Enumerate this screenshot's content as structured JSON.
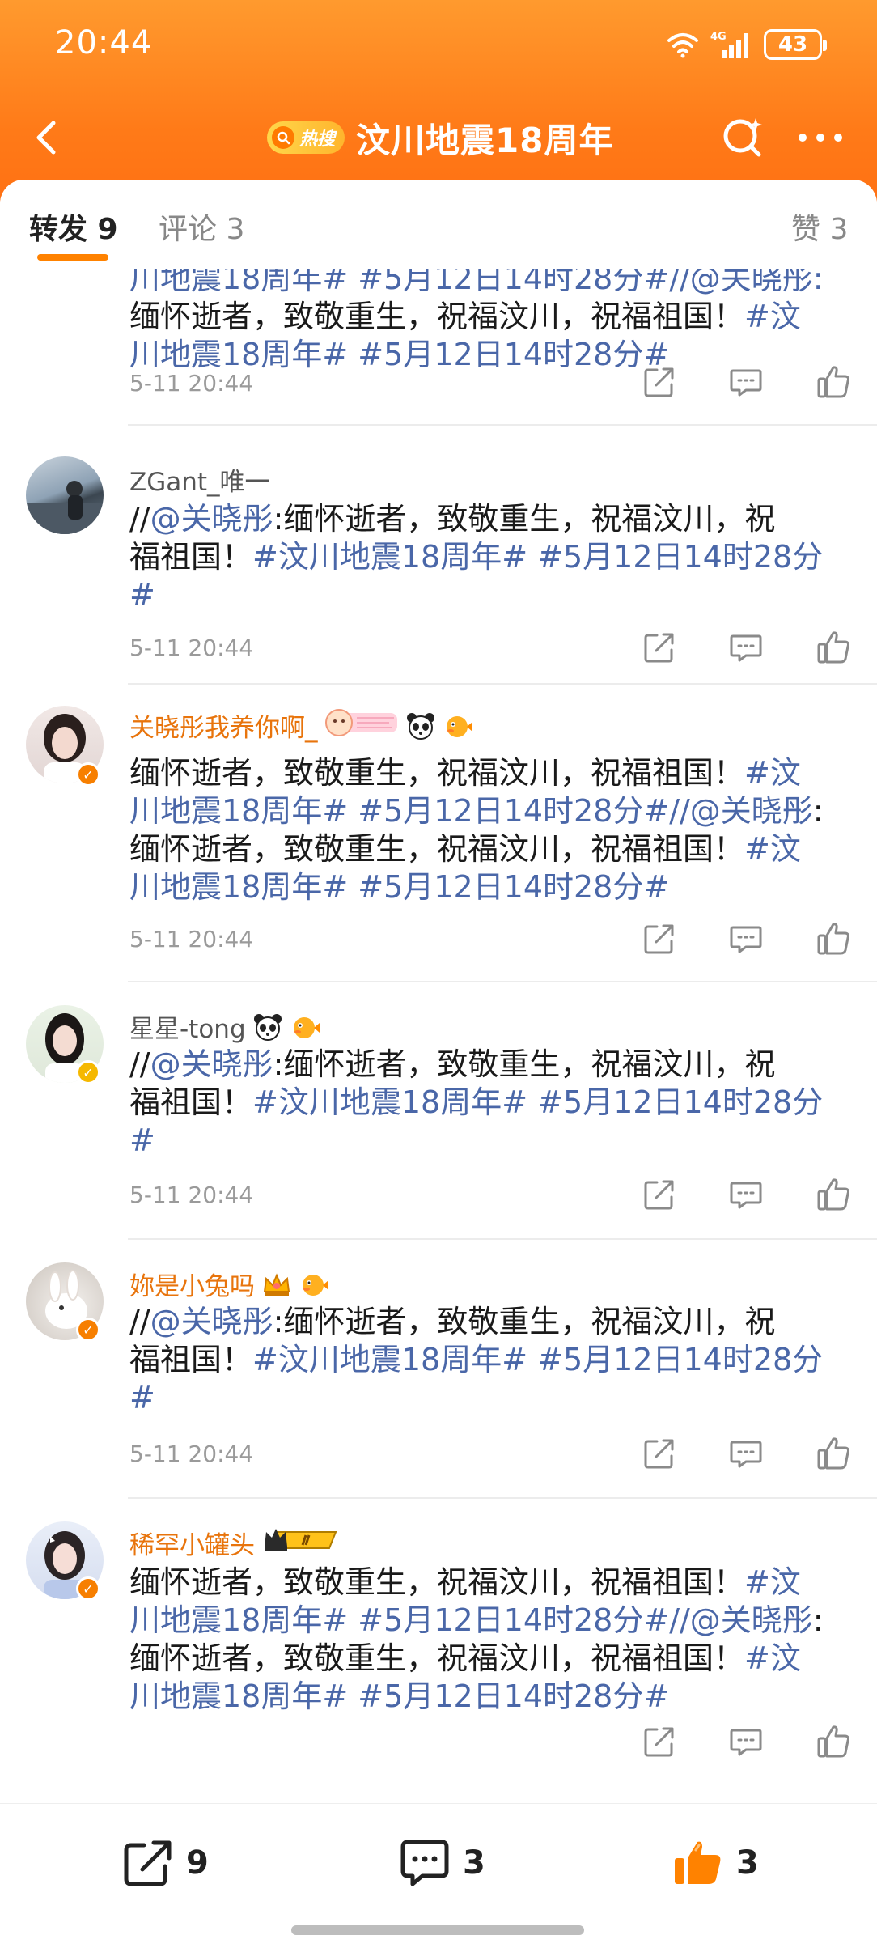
{
  "status": {
    "time": "20:44",
    "network": "4G",
    "battery": "43"
  },
  "nav": {
    "hot_badge": "热搜",
    "title": "汶川地震18周年",
    "icons": [
      "back-arrow-icon",
      "search-icon",
      "more-icon"
    ]
  },
  "tabs": {
    "repost_label": "转发 9",
    "comment_label": "评论 3",
    "like_label": "赞 3"
  },
  "posts": [
    {
      "username": "",
      "text_plain": "",
      "text_lines": [
        [
          {
            "t": "川地震18周年# #5月12日14时28分#//@关晓彤:",
            "link": true
          }
        ],
        [
          {
            "t": "缅怀逝者，致敬重生，祝福汶川，祝福祖国！",
            "link": false
          },
          {
            "t": "#汶",
            "link": true
          }
        ],
        [
          {
            "t": "川地震18周年# #5月12日14时28分#",
            "link": true
          }
        ]
      ],
      "time": "5-11 20:44"
    },
    {
      "username": "ZGant_唯一",
      "text_lines": [
        [
          {
            "t": "//",
            "link": false
          },
          {
            "t": "@关晓彤",
            "link": true
          },
          {
            "t": ":缅怀逝者，致敬重生，祝福汶川，祝",
            "link": false
          }
        ],
        [
          {
            "t": "福祖国！",
            "link": false
          },
          {
            "t": "#汶川地震18周年# #5月12日14时28分",
            "link": true
          }
        ],
        [
          {
            "t": "#",
            "link": true
          }
        ]
      ],
      "time": "5-11 20:44"
    },
    {
      "username": "关晓彤我养你啊_",
      "text_lines": [
        [
          {
            "t": "缅怀逝者，致敬重生，祝福汶川，祝福祖国！",
            "link": false
          },
          {
            "t": "#汶",
            "link": true
          }
        ],
        [
          {
            "t": "川地震18周年# #5月12日14时28分#//@关晓彤",
            "link": true
          },
          {
            "t": ":",
            "link": false
          }
        ],
        [
          {
            "t": "缅怀逝者，致敬重生，祝福汶川，祝福祖国！",
            "link": false
          },
          {
            "t": "#汶",
            "link": true
          }
        ],
        [
          {
            "t": "川地震18周年# #5月12日14时28分#",
            "link": true
          }
        ]
      ],
      "time": "5-11 20:44"
    },
    {
      "username": "星星-tong",
      "text_lines": [
        [
          {
            "t": "//",
            "link": false
          },
          {
            "t": "@关晓彤",
            "link": true
          },
          {
            "t": ":缅怀逝者，致敬重生，祝福汶川，祝",
            "link": false
          }
        ],
        [
          {
            "t": "福祖国！",
            "link": false
          },
          {
            "t": "#汶川地震18周年# #5月12日14时28分",
            "link": true
          }
        ],
        [
          {
            "t": "#",
            "link": true
          }
        ]
      ],
      "time": "5-11 20:44"
    },
    {
      "username": "妳是小兔吗",
      "text_lines": [
        [
          {
            "t": "//",
            "link": false
          },
          {
            "t": "@关晓彤",
            "link": true
          },
          {
            "t": ":缅怀逝者，致敬重生，祝福汶川，祝",
            "link": false
          }
        ],
        [
          {
            "t": "福祖国！",
            "link": false
          },
          {
            "t": "#汶川地震18周年# #5月12日14时28分",
            "link": true
          }
        ],
        [
          {
            "t": "#",
            "link": true
          }
        ]
      ],
      "time": "5-11 20:44"
    },
    {
      "username": "稀罕小罐头",
      "text_lines": [
        [
          {
            "t": "缅怀逝者，致敬重生，祝福汶川，祝福祖国！",
            "link": false
          },
          {
            "t": "#汶",
            "link": true
          }
        ],
        [
          {
            "t": "川地震18周年# #5月12日14时28分#//@关晓彤",
            "link": true
          },
          {
            "t": ":",
            "link": false
          }
        ],
        [
          {
            "t": "缅怀逝者，致敬重生，祝福汶川，祝福祖国！",
            "link": false
          },
          {
            "t": "#汶",
            "link": true
          }
        ],
        [
          {
            "t": "川地震18周年# #5月12日14时28分#",
            "link": true
          }
        ]
      ],
      "time": ""
    }
  ],
  "bottom": {
    "repost_count": "9",
    "comment_count": "3",
    "like_count": "3"
  },
  "colors": {
    "brand": "#ff7a18",
    "link": "#4a67a8",
    "vip_name": "#e8740c",
    "like_orange": "#ff8200"
  }
}
